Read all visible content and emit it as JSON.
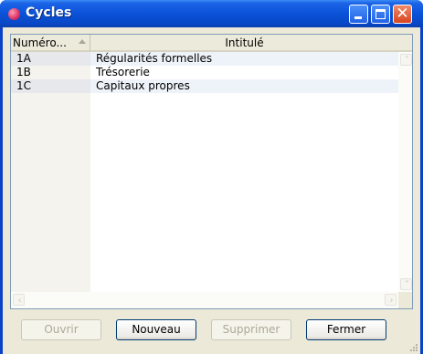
{
  "window": {
    "title": "Cycles",
    "accent": "#0a52d8",
    "close_color": "#d8441f"
  },
  "list": {
    "columns": [
      {
        "label": "Numéro..."
      },
      {
        "label": "Intitulé"
      }
    ],
    "sorted_column": "Numéro...",
    "rows": [
      {
        "numero": "1A",
        "intitule": "Régularités formelles"
      },
      {
        "numero": "1B",
        "intitule": "Trésorerie"
      },
      {
        "numero": "1C",
        "intitule": "Capitaux propres"
      }
    ]
  },
  "buttons": {
    "ouvrir": {
      "label": "Ouvrir",
      "enabled": false
    },
    "nouveau": {
      "label": "Nouveau",
      "enabled": true
    },
    "supprimer": {
      "label": "Supprimer",
      "enabled": false
    },
    "fermer": {
      "label": "Fermer",
      "enabled": true
    }
  },
  "icons": {
    "app": "cycles-app-icon",
    "minimize": "minimize-icon",
    "maximize": "maximize-icon",
    "close": "close-icon",
    "sort": "sort-ascending-icon",
    "resize": "resize-grip-icon"
  }
}
